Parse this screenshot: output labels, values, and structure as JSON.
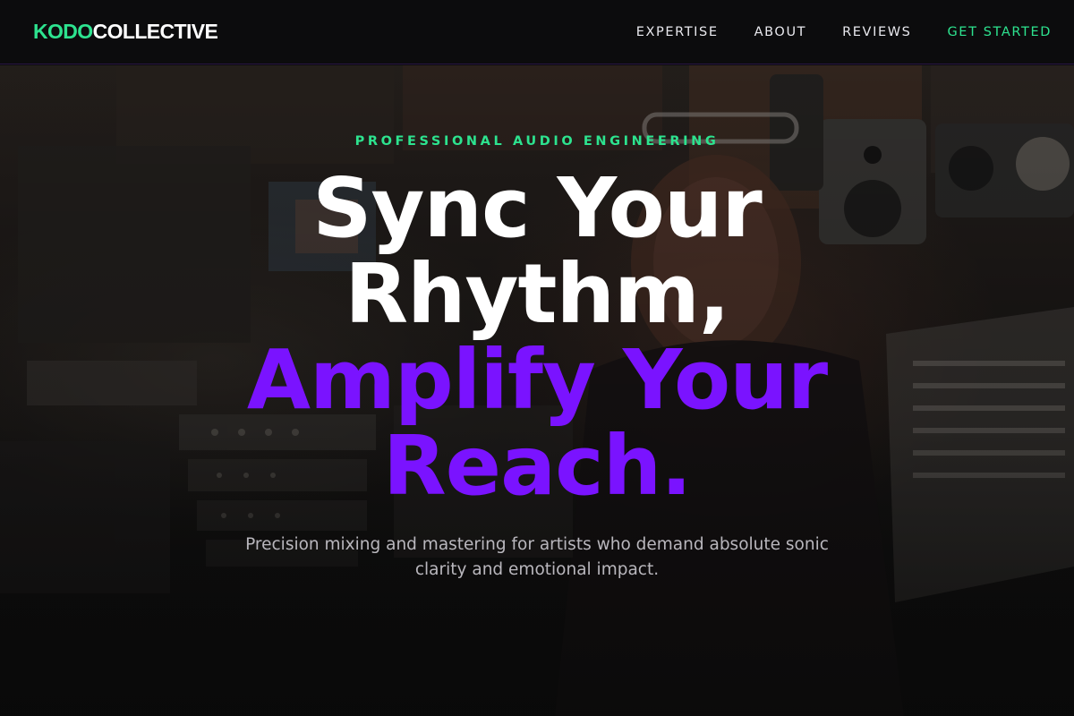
{
  "header": {
    "logo_accent": "KODO",
    "logo_rest": "COLLECTIVE",
    "nav": [
      {
        "label": "EXPERTISE"
      },
      {
        "label": "ABOUT"
      },
      {
        "label": "REVIEWS"
      },
      {
        "label": "GET STARTED"
      }
    ]
  },
  "hero": {
    "eyebrow": "PROFESSIONAL AUDIO ENGINEERING",
    "headline_lines": [
      "Sync Your",
      "Rhythm,",
      "Amplify Your",
      "Reach."
    ],
    "subtext": "Precision mixing and mastering for artists who demand absolute sonic clarity and emotional impact."
  },
  "colors": {
    "accent_green": "#2de38f",
    "accent_purple": "#7a13ff",
    "background": "#0b0b0c"
  }
}
